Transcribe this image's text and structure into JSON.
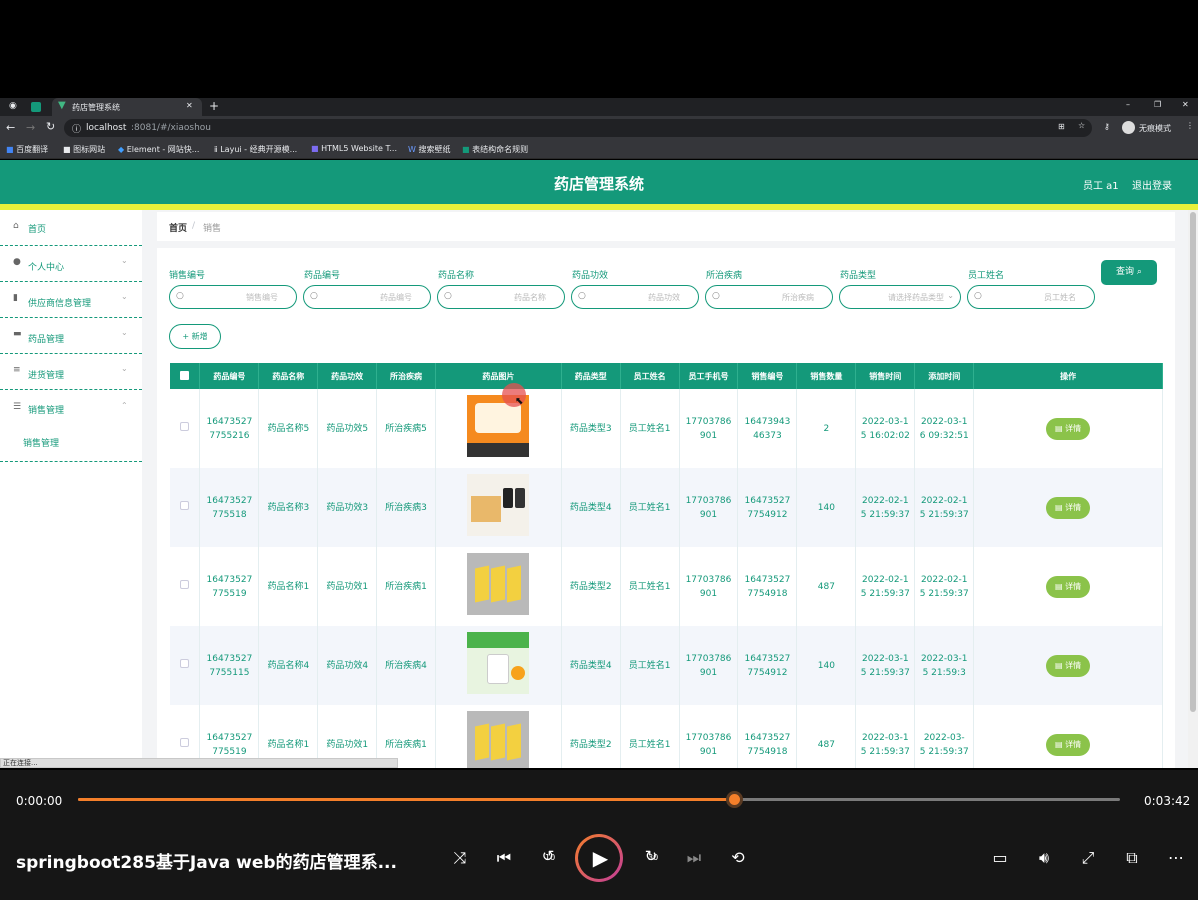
{
  "browser": {
    "tab_title": "药店管理系统",
    "new_tab": "+",
    "url_host": "localhost",
    "url_rest": ":8081/#/xiaoshou",
    "profile_label": "无痕模式",
    "window_controls": [
      "–",
      "❐",
      "✕"
    ],
    "bookmarks": [
      "百度翻译",
      "图标网站",
      "Element - 网站快...",
      "Layui - 经典开源模...",
      "HTML5 Website T...",
      "搜索壁纸",
      "表结构命名规则"
    ]
  },
  "app": {
    "title": "药店管理系统",
    "user": "员工 a1",
    "logout": "退出登录",
    "sidebar": [
      {
        "label": "首页",
        "icon": "home-icon",
        "glyph": "⌂"
      },
      {
        "label": "个人中心",
        "icon": "user-icon",
        "glyph": "●",
        "chevron": "⌄"
      },
      {
        "label": "供应商信息管理",
        "icon": "chart-icon",
        "glyph": "▮",
        "chevron": "⌄"
      },
      {
        "label": "药品管理",
        "icon": "monitor-icon",
        "glyph": "▬",
        "chevron": "⌄"
      },
      {
        "label": "进货管理",
        "icon": "list-icon",
        "glyph": "≡",
        "chevron": "⌄"
      },
      {
        "label": "销售管理",
        "icon": "sliders-icon",
        "glyph": "☰",
        "chevron": "⌃"
      }
    ],
    "submenu": "销售管理",
    "breadcrumb": {
      "home": "首页",
      "sep": "/",
      "current": "销售"
    },
    "search_fields": [
      {
        "label": "销售编号",
        "placeholder": "销售编号"
      },
      {
        "label": "药品编号",
        "placeholder": "药品编号"
      },
      {
        "label": "药品名称",
        "placeholder": "药品名称"
      },
      {
        "label": "药品功效",
        "placeholder": "药品功效"
      },
      {
        "label": "所治疾病",
        "placeholder": "所治疾病"
      },
      {
        "label": "药品类型",
        "placeholder": "请选择药品类型"
      },
      {
        "label": "员工姓名",
        "placeholder": "员工姓名"
      }
    ],
    "query_button": "查询",
    "add_button": "+ 新增",
    "columns": [
      "药品编号",
      "药品名称",
      "药品功效",
      "所治疾病",
      "药品图片",
      "药品类型",
      "员工姓名",
      "员工手机号",
      "销售编号",
      "销售数量",
      "销售时间",
      "添加时间",
      "操作"
    ],
    "detail_label": "详情",
    "rows": [
      {
        "drug_no": [
          "16473527",
          "7755216"
        ],
        "name": "药品名称5",
        "effect": "药品功效5",
        "disease": "所治疾病5",
        "image": "orange-pill-box",
        "type": "药品类型3",
        "staff": "员工姓名1",
        "phone": [
          "17703786",
          "901"
        ],
        "sale_no": [
          "16473943",
          "46373"
        ],
        "qty": "2",
        "sale_time": [
          "2022-03-1",
          "5 16:02:02"
        ],
        "added": [
          "2022-03-1",
          "6 09:32:51"
        ]
      },
      {
        "drug_no": [
          "16473527",
          "775518"
        ],
        "name": "药品名称3",
        "effect": "药品功效3",
        "disease": "所治疾病3",
        "image": "supplement-bottles",
        "type": "药品类型4",
        "staff": "员工姓名1",
        "phone": [
          "17703786",
          "901"
        ],
        "sale_no": [
          "16473527",
          "7754912"
        ],
        "qty": "140",
        "sale_time": [
          "2022-02-1",
          "5 21:59:37"
        ],
        "added": [
          "2022-02-1",
          "5 21:59:37"
        ]
      },
      {
        "drug_no": [
          "16473527",
          "775519"
        ],
        "name": "药品名称1",
        "effect": "药品功效1",
        "disease": "所治疾病1",
        "image": "yellow-boxes",
        "type": "药品类型2",
        "staff": "员工姓名1",
        "phone": [
          "17703786",
          "901"
        ],
        "sale_no": [
          "16473527",
          "7754918"
        ],
        "qty": "487",
        "sale_time": [
          "2022-02-1",
          "5 21:59:37"
        ],
        "added": [
          "2022-02-1",
          "5 21:59:37"
        ]
      },
      {
        "drug_no": [
          "16473527",
          "7755115"
        ],
        "name": "药品名称4",
        "effect": "药品功效4",
        "disease": "所治疾病4",
        "image": "vitamin-c-bottle",
        "type": "药品类型4",
        "staff": "员工姓名1",
        "phone": [
          "17703786",
          "901"
        ],
        "sale_no": [
          "16473527",
          "7754912"
        ],
        "qty": "140",
        "sale_time": [
          "2022-03-1",
          "5 21:59:37"
        ],
        "added": [
          "2022-03-1",
          "5 21:59:3"
        ]
      },
      {
        "drug_no": [
          "16473527",
          "775519"
        ],
        "name": "药品名称1",
        "effect": "药品功效1",
        "disease": "所治疾病1",
        "image": "yellow-boxes",
        "type": "药品类型2",
        "staff": "员工姓名1",
        "phone": [
          "17703786",
          "901"
        ],
        "sale_no": [
          "16473527",
          "7754918"
        ],
        "qty": "487",
        "sale_time": [
          "2022-03-1",
          "5 21:59:37"
        ],
        "added": [
          "2022-03-",
          "5 21:59:37"
        ]
      }
    ],
    "status_text": "正在连接..."
  },
  "player": {
    "current_time": "0:00:00",
    "total_time": "0:03:42",
    "progress": 0.63,
    "title": "springboot285基于Java web的药店管理系...",
    "skip_back": "10",
    "skip_forward": "30",
    "accent": "#f47f2a"
  }
}
